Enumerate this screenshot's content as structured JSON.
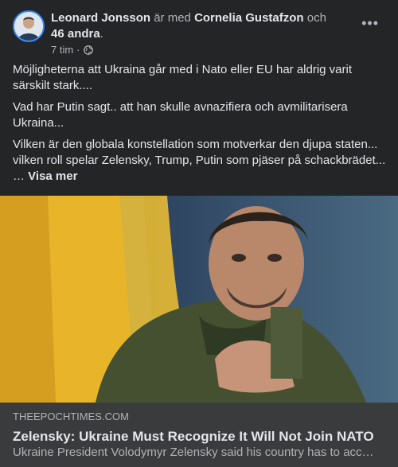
{
  "post": {
    "author": "Leonard Jonsson",
    "with_text": "är med",
    "tagged": "Cornelia Gustafzon",
    "and_text": "och",
    "others": "46 andra",
    "period": ".",
    "time": "7 tim",
    "dot": "·",
    "privacy_icon": "globe-icon",
    "more_label": "•••",
    "paragraphs": [
      "Möjligheterna att Ukraina går med i Nato eller EU har aldrig varit särskilt stark....",
      "Vad har Putin sagt.. att han skulle avnazifiera och avmilitarisera Ukraina...",
      "Vilken är den globala konstellation som motverkar den djupa staten... vilken roll spelar Zelensky, Trump, Putin som pjäser på schackbrädet..."
    ],
    "ellipsis": "…",
    "see_more": "Visa mer"
  },
  "link": {
    "domain": "THEEPOCHTIMES.COM",
    "headline": "Zelensky: Ukraine Must Recognize It Will Not Join NATO",
    "description": "Ukraine President Volodymyr Zelensky said his country has to acc…"
  },
  "colors": {
    "card": "#242526",
    "link_box": "#3a3b3c",
    "flag_blue": "#3a6ab8",
    "flag_yellow": "#f2c230"
  }
}
